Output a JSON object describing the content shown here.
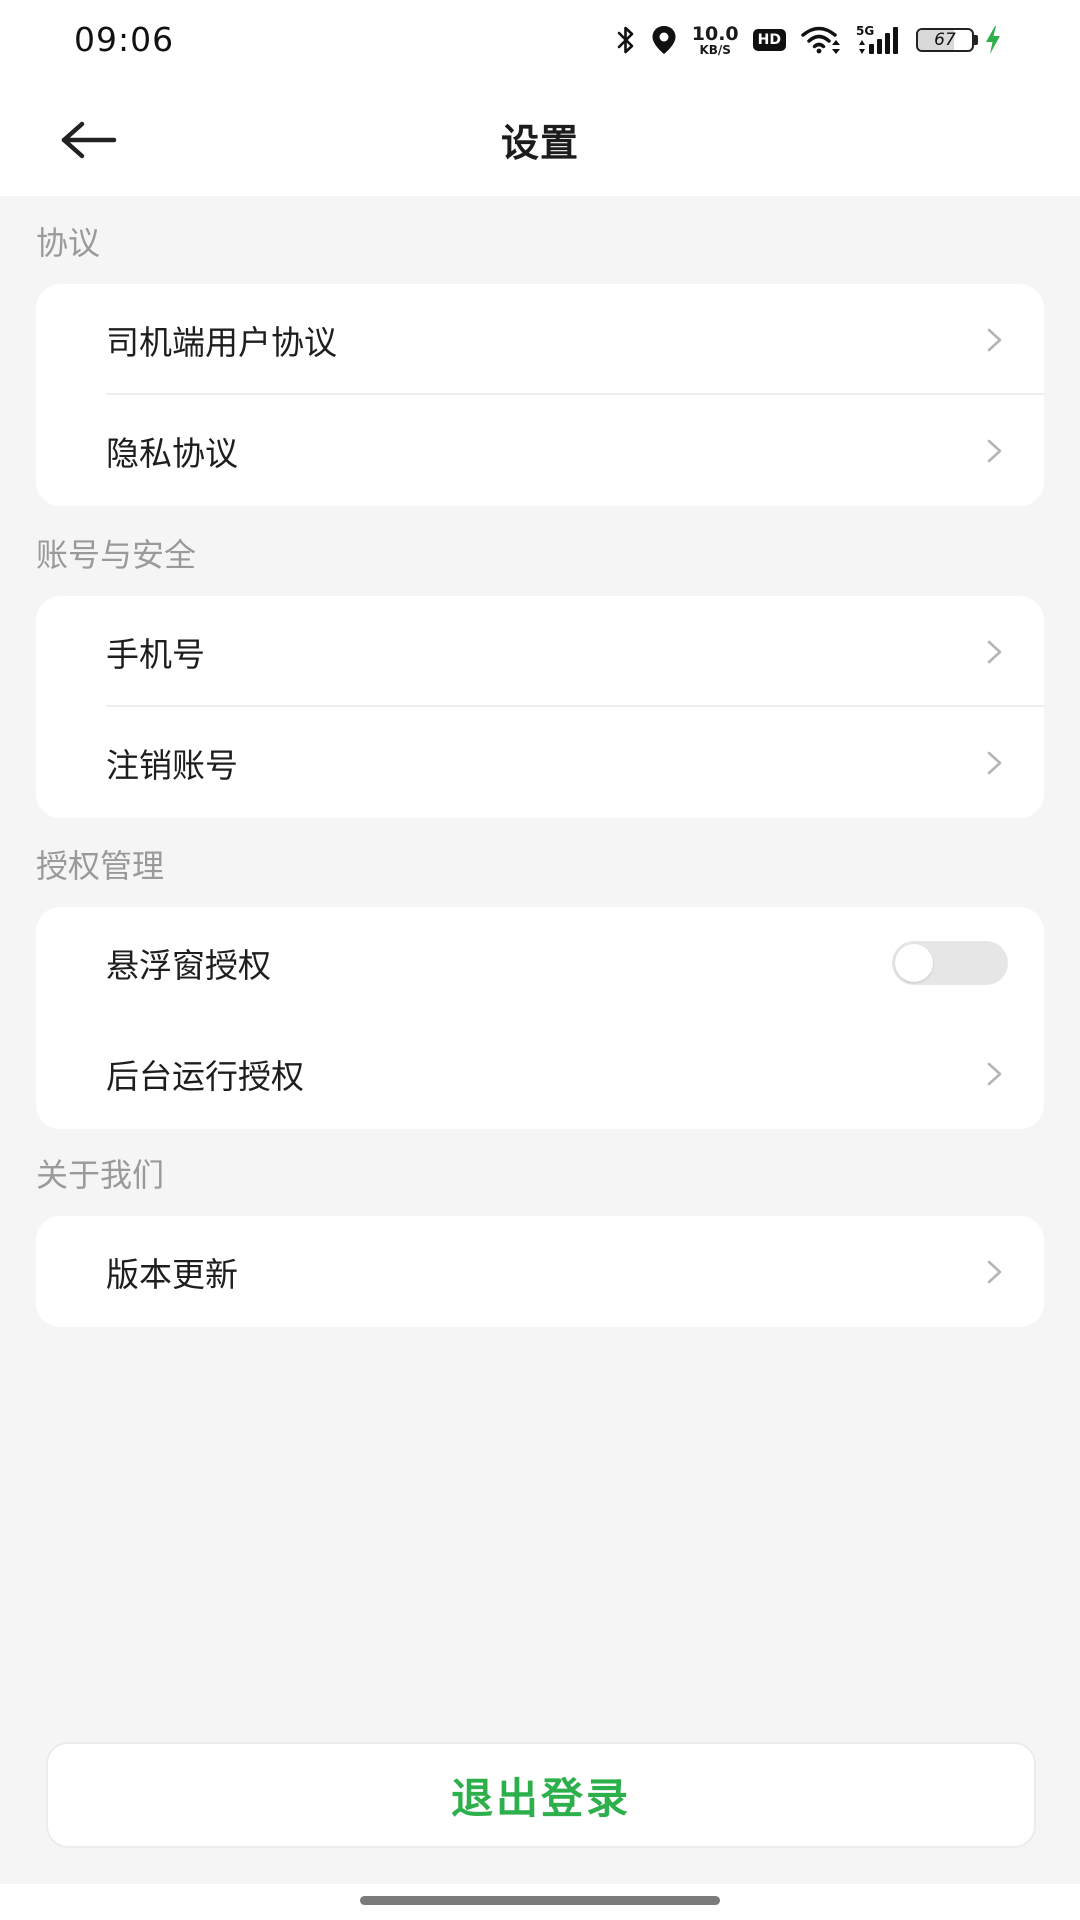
{
  "status_bar": {
    "time": "09:06",
    "net_speed_value": "10.0",
    "net_speed_unit": "KB/S",
    "hd_label": "HD",
    "network_label": "5G",
    "battery_level": "67",
    "icons": [
      "bluetooth-icon",
      "location-icon",
      "wifi-icon",
      "signal-icon",
      "charging-icon"
    ]
  },
  "header": {
    "title": "设置",
    "back_icon": "arrow-left-icon"
  },
  "sections": [
    {
      "label": "协议",
      "items": [
        {
          "label": "司机端用户协议",
          "control": "chevron"
        },
        {
          "label": "隐私协议",
          "control": "chevron"
        }
      ]
    },
    {
      "label": "账号与安全",
      "items": [
        {
          "label": "手机号",
          "control": "chevron"
        },
        {
          "label": "注销账号",
          "control": "chevron"
        }
      ]
    },
    {
      "label": "授权管理",
      "items": [
        {
          "label": "悬浮窗授权",
          "control": "toggle",
          "toggle_on": false
        },
        {
          "label": "后台运行授权",
          "control": "chevron"
        }
      ]
    },
    {
      "label": "关于我们",
      "items": [
        {
          "label": "版本更新",
          "control": "chevron"
        }
      ]
    }
  ],
  "logout": {
    "label": "退出登录"
  },
  "colors": {
    "accent_green": "#2db04b",
    "charging_green": "#2db04b",
    "background": "#f5f5f5",
    "section_label": "#9a9a9a",
    "chevron": "#b5b5b5"
  }
}
